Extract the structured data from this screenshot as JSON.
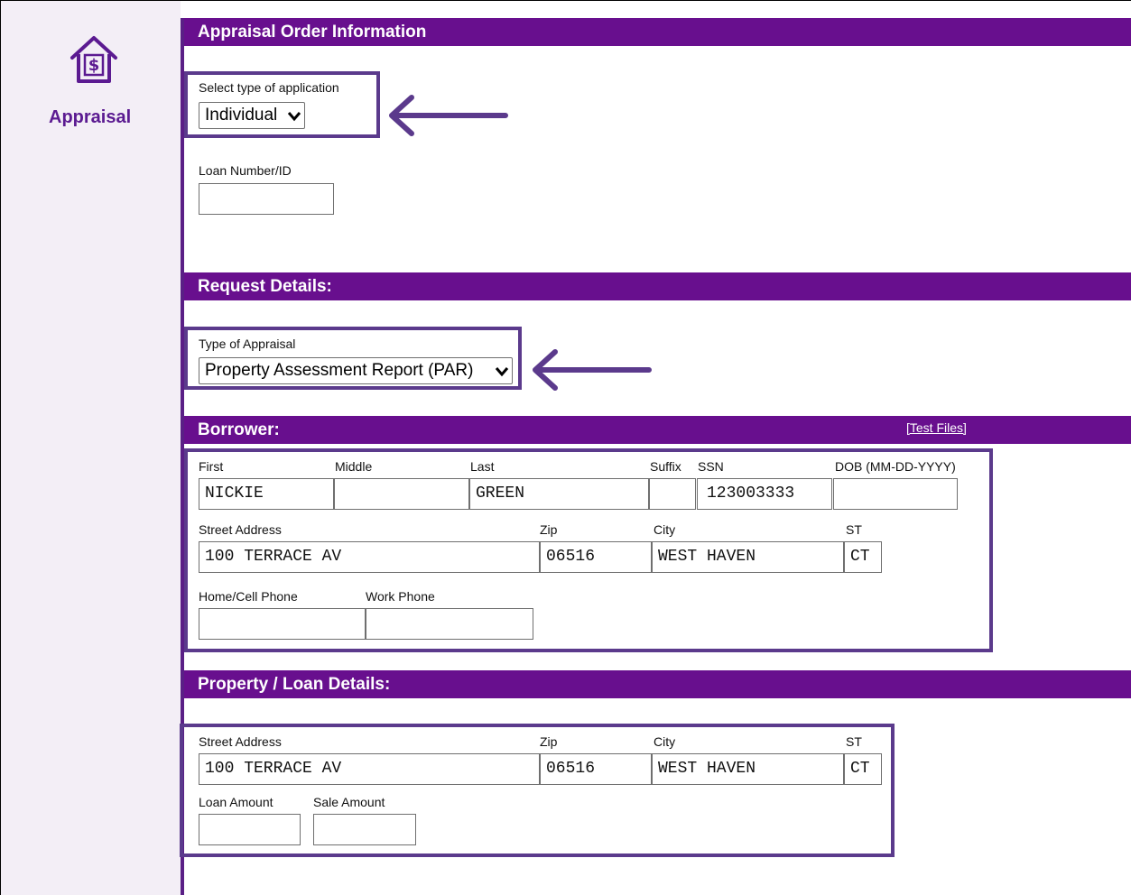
{
  "sidebar": {
    "label": "Appraisal",
    "icon": "house-dollar-icon"
  },
  "sections": {
    "order_info": "Appraisal Order Information",
    "request": "Request Details:",
    "borrower": "Borrower:",
    "property": "Property / Loan Details:"
  },
  "test_files": "[Test Files]",
  "order": {
    "app_type_label": "Select type of application",
    "app_type_value": "Individual",
    "loan_number_label": "Loan Number/ID",
    "loan_number_value": ""
  },
  "request": {
    "appraisal_type_label": "Type of Appraisal",
    "appraisal_type_value": "Property Assessment Report (PAR)"
  },
  "borrower": {
    "labels": {
      "first": "First",
      "middle": "Middle",
      "last": "Last",
      "suffix": "Suffix",
      "ssn": "SSN",
      "dob": "DOB (MM-DD-YYYY)",
      "street": "Street Address",
      "zip": "Zip",
      "city": "City",
      "st": "ST",
      "home_phone": "Home/Cell Phone",
      "work_phone": "Work Phone"
    },
    "values": {
      "first": "NICKIE",
      "middle": "",
      "last": "GREEN",
      "suffix": "",
      "ssn": "123003333",
      "dob": "",
      "street": "100 TERRACE AV",
      "zip": "06516",
      "city": "WEST HAVEN",
      "st": "CT",
      "home_phone": "",
      "work_phone": ""
    }
  },
  "property": {
    "labels": {
      "street": "Street Address",
      "zip": "Zip",
      "city": "City",
      "st": "ST",
      "loan_amount": "Loan Amount",
      "sale_amount": "Sale Amount"
    },
    "values": {
      "street": "100 TERRACE AV",
      "zip": "06516",
      "city": "WEST HAVEN",
      "st": "CT",
      "loan_amount": "",
      "sale_amount": ""
    }
  },
  "colors": {
    "header": "#680f8e",
    "highlight": "#5b3a8c",
    "sidebar_text": "#5b1a91"
  }
}
